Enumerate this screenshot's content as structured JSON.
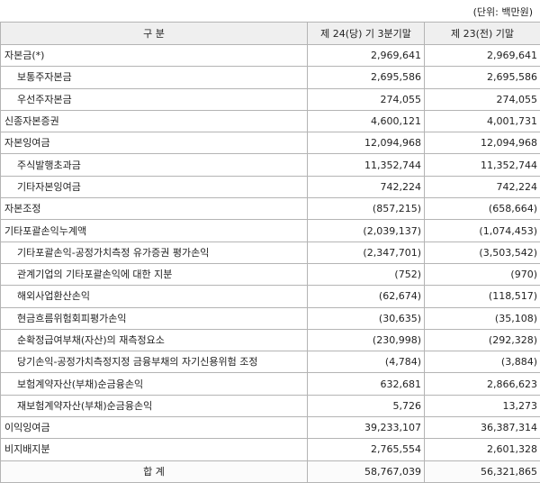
{
  "unit_label": "(단위: 백만원)",
  "columns": [
    "구 분",
    "제 24(당) 기 3분기말",
    "제 23(전) 기말"
  ],
  "rows": [
    {
      "label": "자본금(*)",
      "level": 0,
      "current": "2,969,641",
      "previous": "2,969,641"
    },
    {
      "label": "보통주자본금",
      "level": 1,
      "current": "2,695,586",
      "previous": "2,695,586"
    },
    {
      "label": "우선주자본금",
      "level": 1,
      "current": "274,055",
      "previous": "274,055"
    },
    {
      "label": "신종자본증권",
      "level": 0,
      "current": "4,600,121",
      "previous": "4,001,731"
    },
    {
      "label": "자본잉여금",
      "level": 0,
      "current": "12,094,968",
      "previous": "12,094,968"
    },
    {
      "label": "주식발행초과금",
      "level": 1,
      "current": "11,352,744",
      "previous": "11,352,744"
    },
    {
      "label": "기타자본잉여금",
      "level": 1,
      "current": "742,224",
      "previous": "742,224"
    },
    {
      "label": "자본조정",
      "level": 0,
      "current": "(857,215)",
      "previous": "(658,664)"
    },
    {
      "label": "기타포괄손익누계액",
      "level": 0,
      "current": "(2,039,137)",
      "previous": "(1,074,453)"
    },
    {
      "label": "기타포괄손익-공정가치측정 유가증권 평가손익",
      "level": 1,
      "current": "(2,347,701)",
      "previous": "(3,503,542)"
    },
    {
      "label": "관계기업의 기타포괄손익에 대한 지분",
      "level": 1,
      "current": "(752)",
      "previous": "(970)"
    },
    {
      "label": "해외사업환산손익",
      "level": 1,
      "current": "(62,674)",
      "previous": "(118,517)"
    },
    {
      "label": "현금흐름위험회피평가손익",
      "level": 1,
      "current": "(30,635)",
      "previous": "(35,108)"
    },
    {
      "label": "순확정급여부채(자산)의 재측정요소",
      "level": 1,
      "current": "(230,998)",
      "previous": "(292,328)"
    },
    {
      "label": "당기손익-공정가치측정지정 금융부채의 자기신용위험 조정",
      "level": 1,
      "current": "(4,784)",
      "previous": "(3,884)"
    },
    {
      "label": "보험계약자산(부채)순금융손익",
      "level": 1,
      "current": "632,681",
      "previous": "2,866,623"
    },
    {
      "label": "재보험계약자산(부채)순금융손익",
      "level": 1,
      "current": "5,726",
      "previous": "13,273"
    },
    {
      "label": "이익잉여금",
      "level": 0,
      "current": "39,233,107",
      "previous": "36,387,314"
    },
    {
      "label": "비지배지분",
      "level": 0,
      "current": "2,765,554",
      "previous": "2,601,328"
    }
  ],
  "total": {
    "label": "합 계",
    "current": "58,767,039",
    "previous": "56,321,865"
  }
}
